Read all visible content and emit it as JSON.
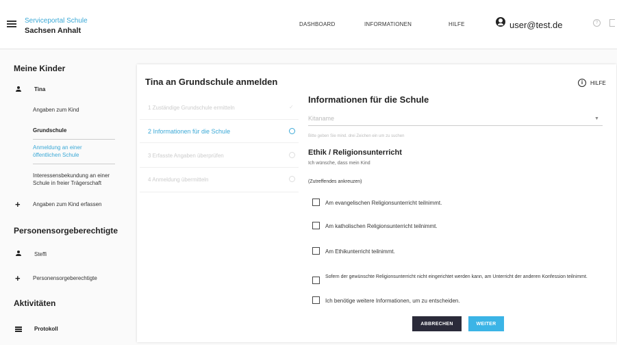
{
  "header": {
    "brand_top": "Serviceportal Schule",
    "brand_bottom": "Sachsen Anhalt",
    "nav": [
      "DASHBOARD",
      "INFORMATIONEN",
      "HILFE"
    ],
    "user_email": "user@test.de",
    "icons": [
      "menu-icon",
      "user-icon",
      "help-circle-icon",
      "logout-icon"
    ]
  },
  "sidebar": {
    "kinder_heading": "Meine Kinder",
    "child_name": "Tina",
    "angaben": "Angaben zum Kind",
    "grundschule": "Grundschule",
    "anmeldung_line1": "Anmeldung an einer",
    "anmeldung_line2": "öffentlichen Schule",
    "interesse_line1": "Interessensbekundung an einer",
    "interesse_line2": "Schule in freier Trägerschaft",
    "add_child": "Angaben zum Kind erfassen",
    "sorge_heading": "Personensorgeberechtigte",
    "sorge_person": "Steffi",
    "add_sorge": "Personensorgeberechtigte",
    "akt_heading": "Aktivitäten",
    "protokoll": "Protokoll"
  },
  "card": {
    "title": "Tina an Grundschule anmelden",
    "help_label": "HILFE",
    "steps": [
      {
        "label": "1  Zuständige Grundschule ermitteln",
        "state": "done"
      },
      {
        "label": "2  Informationen für die Schule",
        "state": "active"
      },
      {
        "label": "3  Erfasste Angaben überprüfen",
        "state": "pending"
      },
      {
        "label": "4  Anmeldung übermitteln",
        "state": "pending"
      }
    ],
    "info_title": "Informationen für die Schule",
    "kita_placeholder": "Kitaname",
    "hint": "Bitte geben Sie mind. drei Zeichen ein um zu suchen",
    "ethik_title": "Ethik / Religionsunterricht",
    "wunsch": "Ich wünsche, dass mein Kind",
    "zutreffendes": "(Zutreffendes ankreuzen)",
    "options": [
      "Am evangelischen Religionsunterricht teilnimmt.",
      "Am katholischen Religionsunterricht teilnimmt.",
      "Am Ethikunterricht teilnimmt.",
      "Sofern der gewünschte Religionsunterricht nicht eingerichtet werden kann, am Unterricht der anderen Konfession teilnimmt.",
      "Ich benötige weitere Informationen, um zu entscheiden."
    ],
    "cancel_label": "ABBRECHEN",
    "next_label": "WEITER"
  },
  "colors": {
    "accent": "#3aa8d6",
    "button_primary": "#3bb4e6",
    "button_dark": "#2b2b3a"
  }
}
